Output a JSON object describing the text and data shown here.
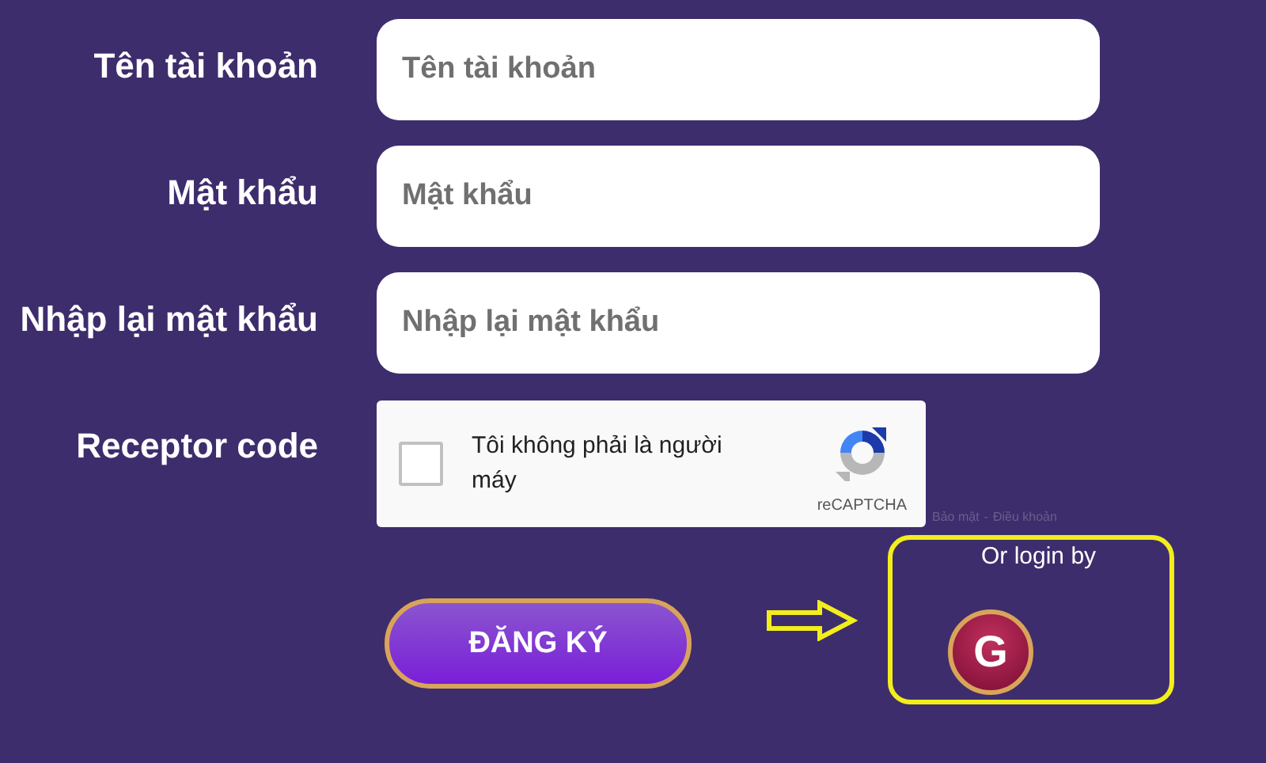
{
  "form": {
    "fields": [
      {
        "label": "Tên tài khoản",
        "placeholder": "Tên tài khoản"
      },
      {
        "label": "Mật khẩu",
        "placeholder": "Mật khẩu"
      },
      {
        "label": "Nhập lại mật khẩu",
        "placeholder": "Nhập lại mật khẩu"
      }
    ],
    "captcha": {
      "label": "Receptor code",
      "text": "Tôi không phải là người máy",
      "checked": false,
      "brand": "reCAPTCHA",
      "links": [
        "Bảo mật",
        "Điều khoản"
      ],
      "separator": "-"
    },
    "submit": "ĐĂNG KÝ"
  },
  "social": {
    "heading": "Or login by",
    "buttons": [
      "G"
    ]
  }
}
